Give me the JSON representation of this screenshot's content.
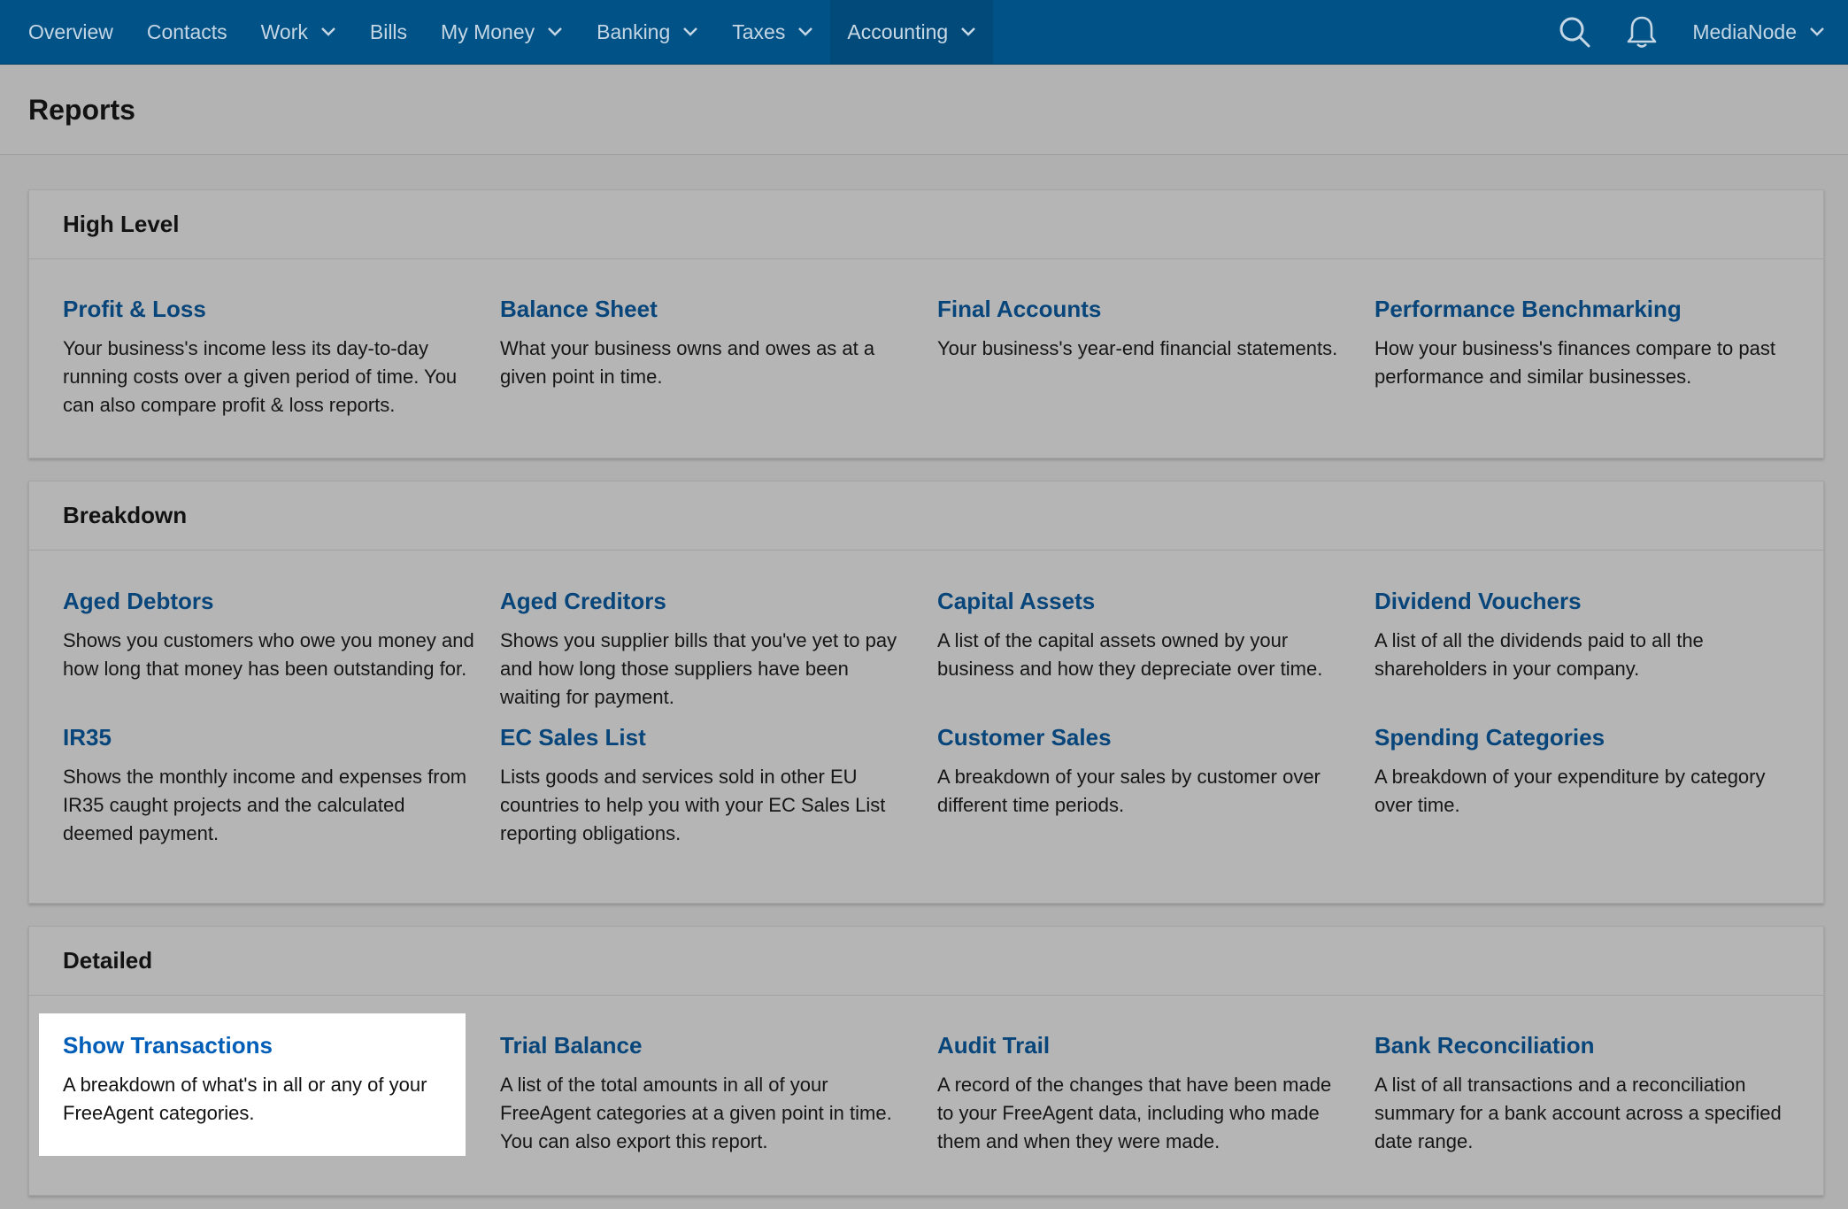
{
  "nav": {
    "items": [
      {
        "label": "Overview",
        "dropdown": false,
        "active": false
      },
      {
        "label": "Contacts",
        "dropdown": false,
        "active": false
      },
      {
        "label": "Work",
        "dropdown": true,
        "active": false
      },
      {
        "label": "Bills",
        "dropdown": false,
        "active": false
      },
      {
        "label": "My Money",
        "dropdown": true,
        "active": false
      },
      {
        "label": "Banking",
        "dropdown": true,
        "active": false
      },
      {
        "label": "Taxes",
        "dropdown": true,
        "active": false
      },
      {
        "label": "Accounting",
        "dropdown": true,
        "active": true
      }
    ],
    "search_icon": "search-icon",
    "notifications_icon": "bell-icon",
    "account_label": "MediaNode"
  },
  "page": {
    "title": "Reports"
  },
  "sections": [
    {
      "title": "High Level",
      "reports": [
        {
          "name": "Profit & Loss",
          "description": "Your business's income less its day-to-day running costs over a given period of time. You can also compare profit & loss reports."
        },
        {
          "name": "Balance Sheet",
          "description": "What your business owns and owes as at a given point in time."
        },
        {
          "name": "Final Accounts",
          "description": "Your business's year-end financial statements."
        },
        {
          "name": "Performance Benchmarking",
          "description": "How your business's finances compare to past performance and similar businesses."
        }
      ]
    },
    {
      "title": "Breakdown",
      "reports": [
        {
          "name": "Aged Debtors",
          "description": "Shows you customers who owe you money and how long that money has been outstanding for."
        },
        {
          "name": "Aged Creditors",
          "description": "Shows you supplier bills that you've yet to pay and how long those suppliers have been waiting for payment."
        },
        {
          "name": "Capital Assets",
          "description": "A list of the capital assets owned by your business and how they depreciate over time."
        },
        {
          "name": "Dividend Vouchers",
          "description": "A list of all the dividends paid to all the shareholders in your company."
        },
        {
          "name": "IR35",
          "description": "Shows the monthly income and expenses from IR35 caught projects and the calculated deemed payment."
        },
        {
          "name": "EC Sales List",
          "description": "Lists goods and services sold in other EU countries to help you with your EC Sales List reporting obligations."
        },
        {
          "name": "Customer Sales",
          "description": "A breakdown of your sales by customer over different time periods."
        },
        {
          "name": "Spending Categories",
          "description": "A breakdown of your expenditure by category over time."
        }
      ]
    },
    {
      "title": "Detailed",
      "reports": [
        {
          "name": "Show Transactions",
          "description": "A breakdown of what's in all or any of your FreeAgent categories."
        },
        {
          "name": "Trial Balance",
          "description": "A list of the total amounts in all of your FreeAgent categories at a given point in time. You can also export this report."
        },
        {
          "name": "Audit Trail",
          "description": "A record of the changes that have been made to your FreeAgent data, including who made them and when they were made."
        },
        {
          "name": "Bank Reconciliation",
          "description": "A list of all transactions and a reconciliation summary for a bank account across a specified date range."
        }
      ]
    }
  ],
  "colors": {
    "nav_bg": "#005287",
    "link": "#07457a",
    "highlight_bg": "#ffffff"
  }
}
